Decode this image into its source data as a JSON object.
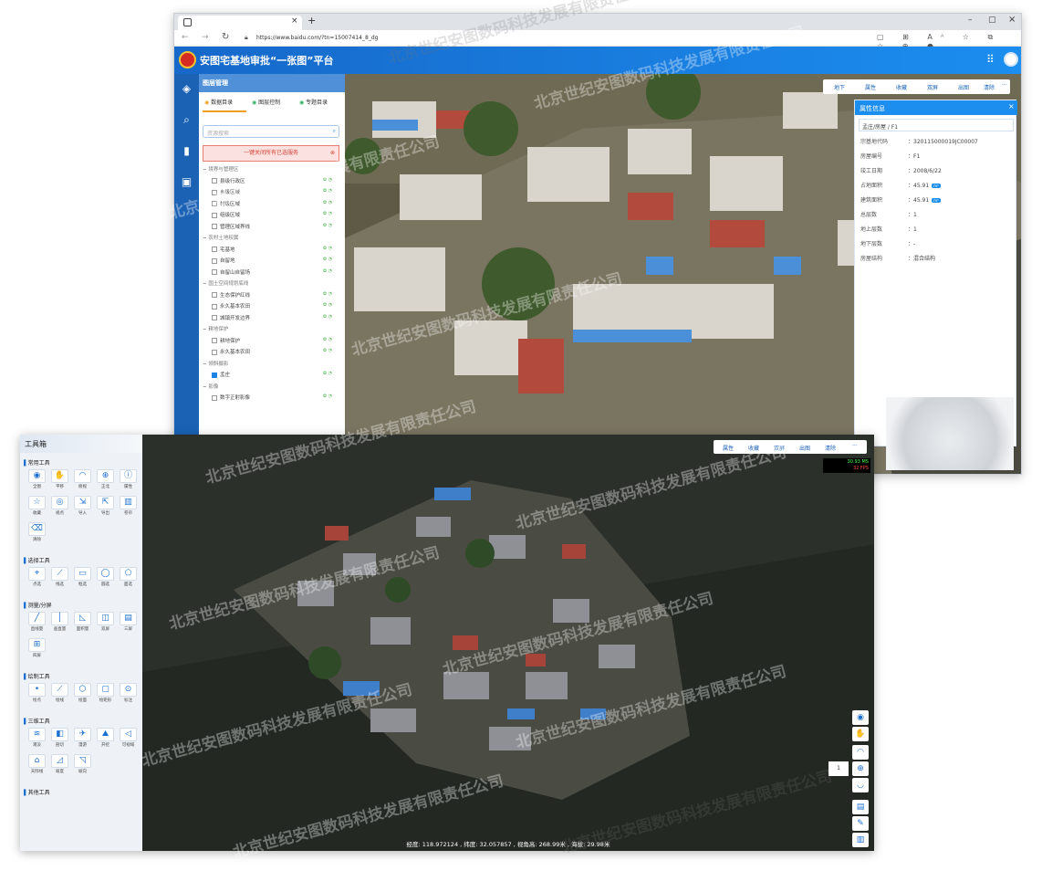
{
  "browser": {
    "url": "https://www.baidu.com/?tn=15007414_8_dg",
    "tab_close": "×",
    "tab_add": "+",
    "win_controls": [
      "–",
      "▢",
      "×"
    ]
  },
  "app": {
    "title": "安图宅基地审批“一张图”平台"
  },
  "layer_panel": {
    "title": "图层管理",
    "tabs": [
      "数据目录",
      "图层控制",
      "专题目录"
    ],
    "search_placeholder": "资源搜索",
    "banner": "一键关闭所有已选服务",
    "groups": [
      {
        "label": "境界与管理区",
        "items": [
          {
            "label": "县级行政区",
            "checked": false
          },
          {
            "label": "乡级区域",
            "checked": false
          },
          {
            "label": "村级区域",
            "checked": false
          },
          {
            "label": "组级区域",
            "checked": false
          },
          {
            "label": "管理区域界线",
            "checked": false
          }
        ]
      },
      {
        "label": "农村土地权属",
        "items": [
          {
            "label": "宅基地",
            "checked": false
          },
          {
            "label": "自留地",
            "checked": false
          },
          {
            "label": "自留山自留场",
            "checked": false
          }
        ]
      },
      {
        "label": "国土空间规划底线",
        "items": [
          {
            "label": "生态保护红线",
            "checked": false
          },
          {
            "label": "永久基本农田",
            "checked": false
          },
          {
            "label": "城镇开发边界",
            "checked": false
          }
        ]
      },
      {
        "label": "耕地保护",
        "items": [
          {
            "label": "耕地保护",
            "checked": false
          },
          {
            "label": "永久基本农田",
            "checked": false
          }
        ]
      },
      {
        "label": "倾斜摄影",
        "items": [
          {
            "label": "孟庄",
            "checked": true
          }
        ]
      },
      {
        "label": "影像",
        "items": [
          {
            "label": "数字正射影像",
            "checked": false
          }
        ]
      }
    ]
  },
  "map_toolbar": [
    "地下",
    "属性",
    "收藏",
    "双屏",
    "出图",
    "清除",
    "···"
  ],
  "attribute_panel": {
    "title": "属性信息",
    "subtitle": "孟庄/房屋 / F1",
    "rows": [
      {
        "key": "宗基地代码",
        "value": "320115000019JC00007"
      },
      {
        "key": "房屋编号",
        "value": "F1"
      },
      {
        "key": "竣工日期",
        "value": "2008/6/22"
      },
      {
        "key": "占地面积",
        "value": "45.91",
        "badge": "m²"
      },
      {
        "key": "建筑面积",
        "value": "45.91",
        "badge": "m²"
      },
      {
        "key": "总层数",
        "value": "1"
      },
      {
        "key": "地上层数",
        "value": "1"
      },
      {
        "key": "地下层数",
        "value": "-"
      },
      {
        "key": "房屋结构",
        "value": "混合结构"
      }
    ]
  },
  "toolbox": {
    "title": "工具箱",
    "sections": [
      {
        "label": "常用工具",
        "tools": [
          {
            "label": "全图",
            "icon": "globe-icon",
            "glyph": "◉"
          },
          {
            "label": "平移",
            "icon": "hand-icon",
            "glyph": "✋"
          },
          {
            "label": "俯视",
            "icon": "eye-top-icon",
            "glyph": "◠"
          },
          {
            "label": "正北",
            "icon": "compass-icon",
            "glyph": "⊕"
          },
          {
            "label": "属性",
            "icon": "info-icon",
            "glyph": "ⓘ"
          },
          {
            "label": "收藏",
            "icon": "star-icon",
            "glyph": "☆"
          },
          {
            "label": "视点",
            "icon": "viewpoint-icon",
            "glyph": "◎"
          },
          {
            "label": "导入",
            "icon": "import-icon",
            "glyph": "⇲"
          },
          {
            "label": "导出",
            "icon": "export-icon",
            "glyph": "⇱"
          },
          {
            "label": "卷帘",
            "icon": "swipe-icon",
            "glyph": "▥"
          },
          {
            "label": "清除",
            "icon": "eraser-icon",
            "glyph": "⌫"
          }
        ]
      },
      {
        "label": "选择工具",
        "tools": [
          {
            "label": "点选",
            "icon": "point-select-icon",
            "glyph": "⌖"
          },
          {
            "label": "线选",
            "icon": "line-select-icon",
            "glyph": "⟋"
          },
          {
            "label": "框选",
            "icon": "box-select-icon",
            "glyph": "▭"
          },
          {
            "label": "圆选",
            "icon": "circle-select-icon",
            "glyph": "◯"
          },
          {
            "label": "面选",
            "icon": "polygon-select-icon",
            "glyph": "⬠"
          }
        ]
      },
      {
        "label": "测量/分屏",
        "tools": [
          {
            "label": "直线量",
            "icon": "measure-line-icon",
            "glyph": "╱"
          },
          {
            "label": "垂直量",
            "icon": "measure-vertical-icon",
            "glyph": "│"
          },
          {
            "label": "面积量",
            "icon": "measure-area-icon",
            "glyph": "◺"
          },
          {
            "label": "双屏",
            "icon": "split-two-icon",
            "glyph": "◫"
          },
          {
            "label": "三屏",
            "icon": "split-three-icon",
            "glyph": "▤"
          },
          {
            "label": "四屏",
            "icon": "split-four-icon",
            "glyph": "⊞"
          }
        ]
      },
      {
        "label": "绘制工具",
        "tools": [
          {
            "label": "绘点",
            "icon": "draw-point-icon",
            "glyph": "•"
          },
          {
            "label": "绘线",
            "icon": "draw-line-icon",
            "glyph": "⟋"
          },
          {
            "label": "绘面",
            "icon": "draw-polygon-icon",
            "glyph": "⬡"
          },
          {
            "label": "绘矩形",
            "icon": "draw-rect-icon",
            "glyph": "▢"
          },
          {
            "label": "标注",
            "icon": "label-icon",
            "glyph": "⊙"
          }
        ]
      },
      {
        "label": "三维工具",
        "tools": [
          {
            "label": "淹没",
            "icon": "flood-icon",
            "glyph": "≋"
          },
          {
            "label": "剖切",
            "icon": "clip-icon",
            "glyph": "◧"
          },
          {
            "label": "漫游",
            "icon": "fly-icon",
            "glyph": "✈"
          },
          {
            "label": "开挖",
            "icon": "excavate-icon",
            "glyph": "⛰"
          },
          {
            "label": "可视域",
            "icon": "viewshed-icon",
            "glyph": "◁"
          },
          {
            "label": "天际线",
            "icon": "skyline-icon",
            "glyph": "⌂"
          },
          {
            "label": "坡度",
            "icon": "slope-icon",
            "glyph": "◿"
          },
          {
            "label": "坡向",
            "icon": "aspect-icon",
            "glyph": "◹"
          }
        ]
      },
      {
        "label": "其他工具",
        "tools": []
      }
    ]
  },
  "map2_toolbar": [
    "属性",
    "收藏",
    "双屏",
    "出图",
    "清除",
    "···"
  ],
  "fps": {
    "ms": "30.93 MS",
    "fps": "32 FPS"
  },
  "status": "经度: 118.972124 , 纬度: 32.057857 , 视角高: 268.99米 , 海拔: 29.98米",
  "zoom_value": "1",
  "watermark": "北京世纪安图数码科技发展有限责任公司"
}
